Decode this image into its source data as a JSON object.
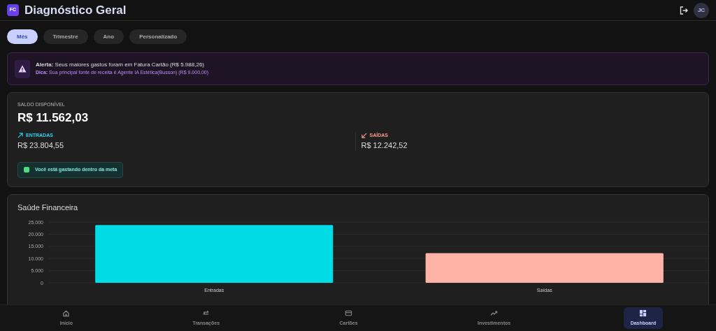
{
  "header": {
    "logo": "FC",
    "title": "Diagnóstico Geral",
    "avatar": "JC"
  },
  "periods": [
    {
      "label": "Mês",
      "selected": true
    },
    {
      "label": "Trimestre",
      "selected": false
    },
    {
      "label": "Ano",
      "selected": false
    },
    {
      "label": "Personalizado",
      "selected": false
    }
  ],
  "alert": {
    "label": "Alerta:",
    "text": "Seus maiores gastos foram em Fatura Cartão (R$ 5.988,26)",
    "tip": "**Dica:** Sua principal fonte de receita é Agente IA Estética(Busson) (R$ 9.000,00)"
  },
  "balance": {
    "label": "SALDO DISPONÍVEL",
    "value": "R$ 11.562,03",
    "flows": [
      {
        "kind": "in",
        "label": "ENTRADAS",
        "value": "R$ 23.804,55"
      },
      {
        "kind": "out",
        "label": "SAÍDAS",
        "value": "R$ 12.242,52"
      }
    ],
    "status": {
      "checked": true,
      "text": "Você está gastando dentro da meta"
    }
  },
  "health": {
    "title": "Saúde Financeira",
    "chart_data": {
      "type": "bar",
      "series": [
        {
          "name": "Entradas",
          "color": "#00dce6",
          "values": [
            23800,
            null
          ]
        },
        {
          "name": "Saídas",
          "color": "#ffb3a7",
          "values": [
            null,
            12200
          ]
        }
      ],
      "grid": true,
      "ylim": [
        0,
        25000
      ],
      "yticks": [
        {
          "value": 0,
          "label": "0"
        },
        {
          "value": 5000,
          "label": "5.000"
        },
        {
          "value": 10000,
          "label": "10.000"
        },
        {
          "value": 15000,
          "label": "15.000"
        },
        {
          "value": 20000,
          "label": "20.000"
        },
        {
          "value": 25000,
          "label": "25.000"
        }
      ]
    }
  },
  "nav": [
    {
      "kind": "home",
      "label": "Início",
      "selected": false
    },
    {
      "kind": "swap",
      "label": "Transações",
      "selected": false
    },
    {
      "kind": "card",
      "label": "Cartões",
      "selected": false
    },
    {
      "kind": "trend",
      "label": "Investimentos",
      "selected": false
    },
    {
      "kind": "dashboard",
      "label": "Dashboard",
      "selected": true
    }
  ]
}
